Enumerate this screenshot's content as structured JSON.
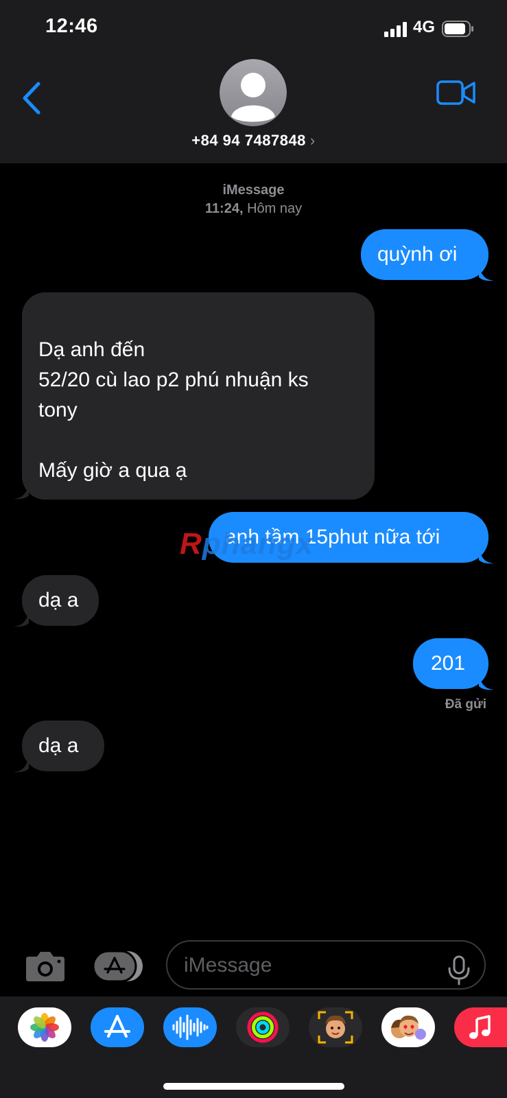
{
  "status": {
    "time": "12:46",
    "network": "4G"
  },
  "header": {
    "contact": "+84 94 7487848",
    "chevron": "›"
  },
  "thread": {
    "service": "iMessage",
    "timestamp_time": "11:24,",
    "timestamp_day": "Hôm nay"
  },
  "messages": [
    {
      "dir": "out",
      "text": "quỳnh ơi"
    },
    {
      "dir": "in",
      "lines": [
        "Dạ anh đến",
        "52/20 cù lao p2 phú nhuận ks",
        "tony",
        "",
        "Mấy giờ a qua ạ"
      ]
    },
    {
      "dir": "out",
      "text": "anh tầm 15phut nữa tới"
    },
    {
      "dir": "in",
      "text": "dạ a"
    },
    {
      "dir": "out",
      "text": "201"
    },
    {
      "dir": "in",
      "text": "dạ a"
    }
  ],
  "delivery": "Đã gửi",
  "watermark": {
    "first": "R",
    "rest": "phangx"
  },
  "compose": {
    "placeholder": "iMessage"
  },
  "app_tray": [
    "photos-icon",
    "app-store-icon",
    "audio-message-icon",
    "activity-icon",
    "memoji-stickers-icon",
    "animoji-icon",
    "music-icon"
  ],
  "colors": {
    "outgoing": "#1a8cff",
    "incoming": "#262628",
    "accent": "#1a8cff",
    "header": "#1c1c1e"
  }
}
